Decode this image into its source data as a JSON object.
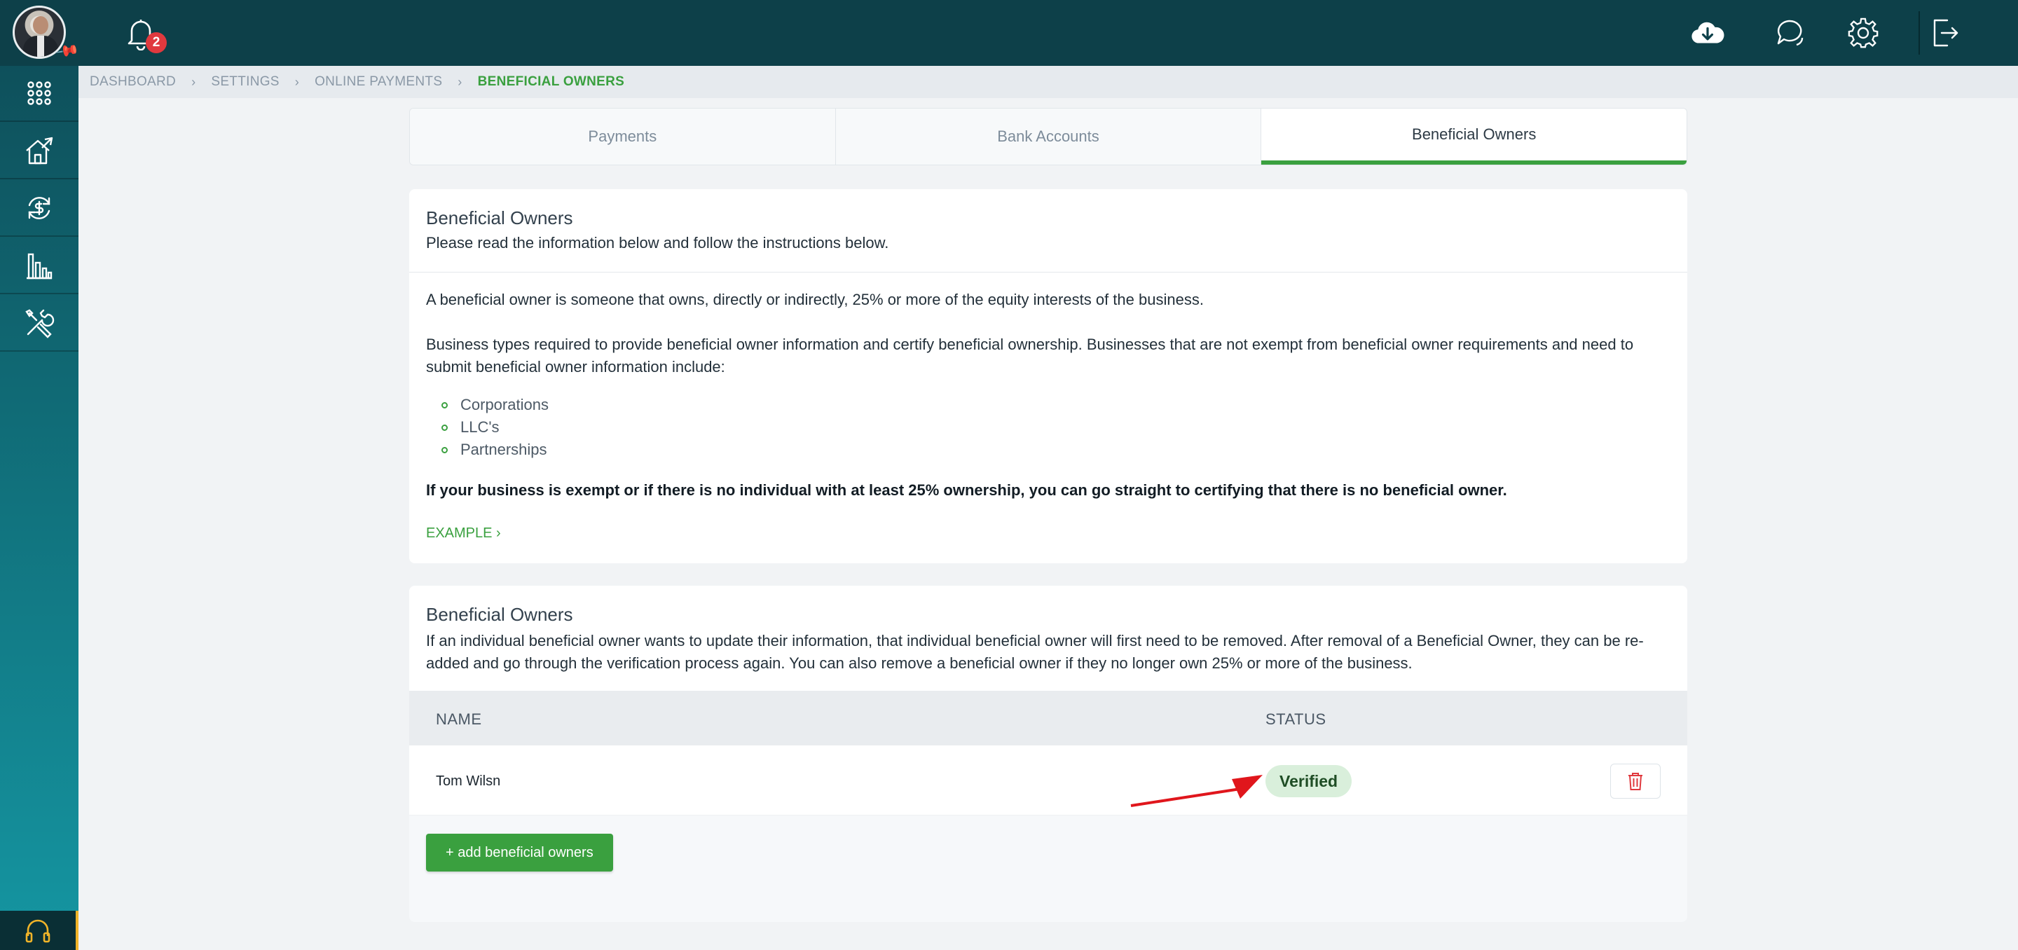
{
  "notifications": {
    "count": "2"
  },
  "breadcrumb": {
    "items": [
      "DASHBOARD",
      "SETTINGS",
      "ONLINE PAYMENTS"
    ],
    "current": "BENEFICIAL OWNERS"
  },
  "tabs": [
    {
      "label": "Payments"
    },
    {
      "label": "Bank Accounts"
    },
    {
      "label": "Beneficial Owners"
    }
  ],
  "info_card": {
    "title": "Beneficial Owners",
    "subtitle": "Please read the information below and follow the instructions below.",
    "para1": "A beneficial owner is someone that owns, directly or indirectly, 25% or more of the equity interests of the business.",
    "para2": "Business types required to provide beneficial owner information and certify beneficial ownership. Businesses that are not exempt from beneficial owner requirements and need to submit beneficial owner information include:",
    "bullets": [
      "Corporations",
      "LLC's",
      "Partnerships"
    ],
    "bold_note": "If your business is exempt or if there is no individual with at least 25% ownership, you can go straight to certifying that there is no beneficial owner.",
    "example_link": "EXAMPLE"
  },
  "owners_card": {
    "title": "Beneficial Owners",
    "description": "If an individual beneficial owner wants to update their information, that individual beneficial owner will first need to be removed. After removal of a Beneficial Owner, they can be re-added and go through the verification process again. You can also remove a beneficial owner if they no longer own 25% or more of the business.",
    "columns": {
      "name": "NAME",
      "status": "STATUS"
    },
    "rows": [
      {
        "name": "Tom Wilsn",
        "status": "Verified"
      }
    ],
    "add_button": "+ add beneficial owners"
  },
  "colors": {
    "accent": "#3aa03f",
    "topbar": "#0d4049",
    "danger": "#e0393e"
  }
}
